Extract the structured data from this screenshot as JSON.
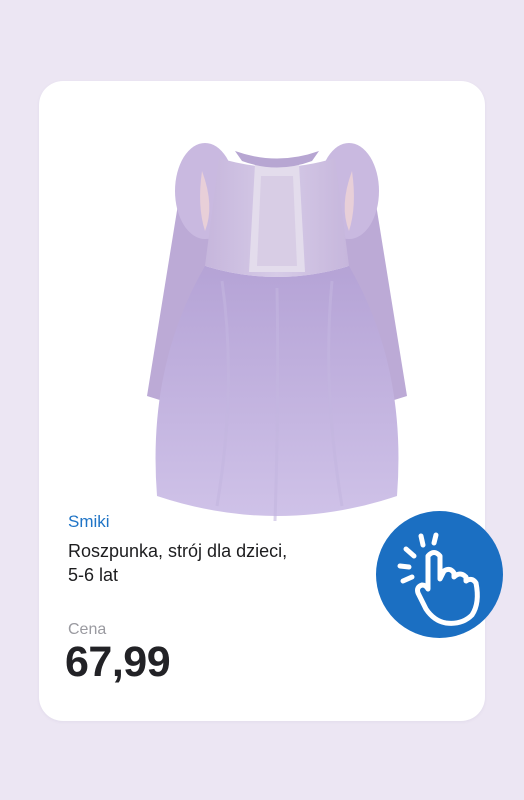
{
  "product": {
    "brand": "Smiki",
    "title": "Roszpunka, strój dla dzieci, 5-6 lat",
    "price_label": "Cena",
    "price": "67,99",
    "image_icon": "dress-image"
  },
  "action": {
    "icon": "tap-hand-icon"
  },
  "colors": {
    "background": "#ece6f3",
    "card": "#ffffff",
    "brand_text": "#1f74c6",
    "button": "#1b6fc2"
  }
}
